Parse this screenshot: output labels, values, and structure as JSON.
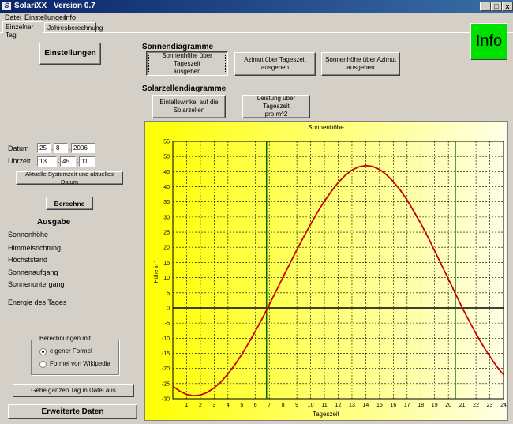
{
  "window": {
    "title": "SolariXX",
    "version": "Version 0.7",
    "minimize": "_",
    "maximize": "□",
    "close": "x"
  },
  "menu": [
    "Datei",
    "Einstellungen",
    "Info"
  ],
  "tabs": [
    "Einzelner Tag",
    "Jahresberechnung"
  ],
  "left": {
    "einstellungen": "Einstellungen",
    "datum_label": "Datum",
    "uhrzeit_label": "Uhrzeit",
    "datum": {
      "day": "25",
      "month": "8",
      "year": "2006"
    },
    "uhrzeit": {
      "h": "13",
      "m": "45",
      "s": "11"
    },
    "datum_sep": ".",
    "uhrzeit_sep": ":",
    "systemzeit_btn": "Aktuelle Systemzeit und aktuelles Datum",
    "berechne_btn": "Berechne",
    "ausgabe_title": "Ausgabe",
    "ausgabe_items": [
      "Sonnenhöhe",
      "Himmelsrichtung",
      "Höchststand",
      "Sonnenaufgang",
      "Sonnenuntergang",
      "Energie des Tages"
    ],
    "berechnungen_title": "Berechnungen mit",
    "radio_eigene": "eigener Formel",
    "radio_wiki": "Formel von Wikipedia",
    "datei_btn": "Gebe ganzen Tag in Datei aus",
    "erweitert_btn": "Erweiterte Daten"
  },
  "right": {
    "sonnendiagramme": "Sonnendiagramme",
    "btn1": "Sonnenhöhe über Tageszeit\nausgeben",
    "btn2": "Azimut über Tageszeit\nausgeben",
    "btn3": "Sonnenhöhe über Azimut\nausgeben",
    "solarzellendiagramme": "Solarzellendiagramme",
    "btn4": "Einfallswinkel auf die\nSolarzellen",
    "btn5": "Leistung über Tageszeit\npro m^2",
    "info": "Info"
  },
  "colors": {
    "curve": "#cc0000",
    "marker": "#006600",
    "grid_bg_start": "#ffff00",
    "grid_bg_end": "#ffffe6"
  },
  "chart_data": {
    "type": "line",
    "title": "Sonnenhöhe",
    "xlabel": "Tageszeit",
    "ylabel": "Höhe in °",
    "xlim": [
      0,
      24
    ],
    "ylim": [
      -30,
      55
    ],
    "xticks": [
      1,
      2,
      3,
      4,
      5,
      6,
      7,
      8,
      9,
      10,
      11,
      12,
      13,
      14,
      15,
      16,
      17,
      18,
      19,
      20,
      21,
      22,
      23,
      24
    ],
    "yticks": [
      -30,
      -25,
      -20,
      -15,
      -10,
      -5,
      0,
      5,
      10,
      15,
      20,
      25,
      30,
      35,
      40,
      45,
      50,
      55
    ],
    "grid": true,
    "series": [
      {
        "x": [
          0,
          0.5,
          1,
          1.5,
          2,
          2.5,
          3,
          3.5,
          4,
          4.5,
          5,
          5.5,
          6,
          6.5,
          7,
          7.5,
          8,
          8.5,
          9,
          9.5,
          10,
          10.5,
          11,
          11.5,
          12,
          12.5,
          13,
          13.5,
          14,
          14.5,
          15,
          15.5,
          16,
          16.5,
          17,
          17.5,
          18,
          18.5,
          19,
          19.5,
          20,
          20.5,
          21,
          21.5,
          22,
          22.5,
          23,
          23.5,
          24
        ],
        "values": [
          -25.9,
          -27.5,
          -28.6,
          -29.0,
          -28.8,
          -27.9,
          -26.4,
          -24.4,
          -21.8,
          -18.8,
          -15.4,
          -11.6,
          -7.6,
          -3.4,
          1.1,
          5.6,
          10.2,
          14.7,
          19.2,
          23.5,
          27.6,
          31.6,
          35.2,
          38.5,
          41.4,
          43.7,
          45.5,
          46.6,
          47.0,
          46.7,
          45.7,
          44.0,
          41.7,
          38.9,
          35.6,
          31.8,
          27.8,
          23.5,
          18.9,
          14.2,
          9.5,
          4.8,
          0.1,
          -4.3,
          -8.5,
          -12.4,
          -16.0,
          -19.3,
          -22.1
        ]
      }
    ],
    "markers_x": [
      6.8,
      20.5
    ]
  }
}
